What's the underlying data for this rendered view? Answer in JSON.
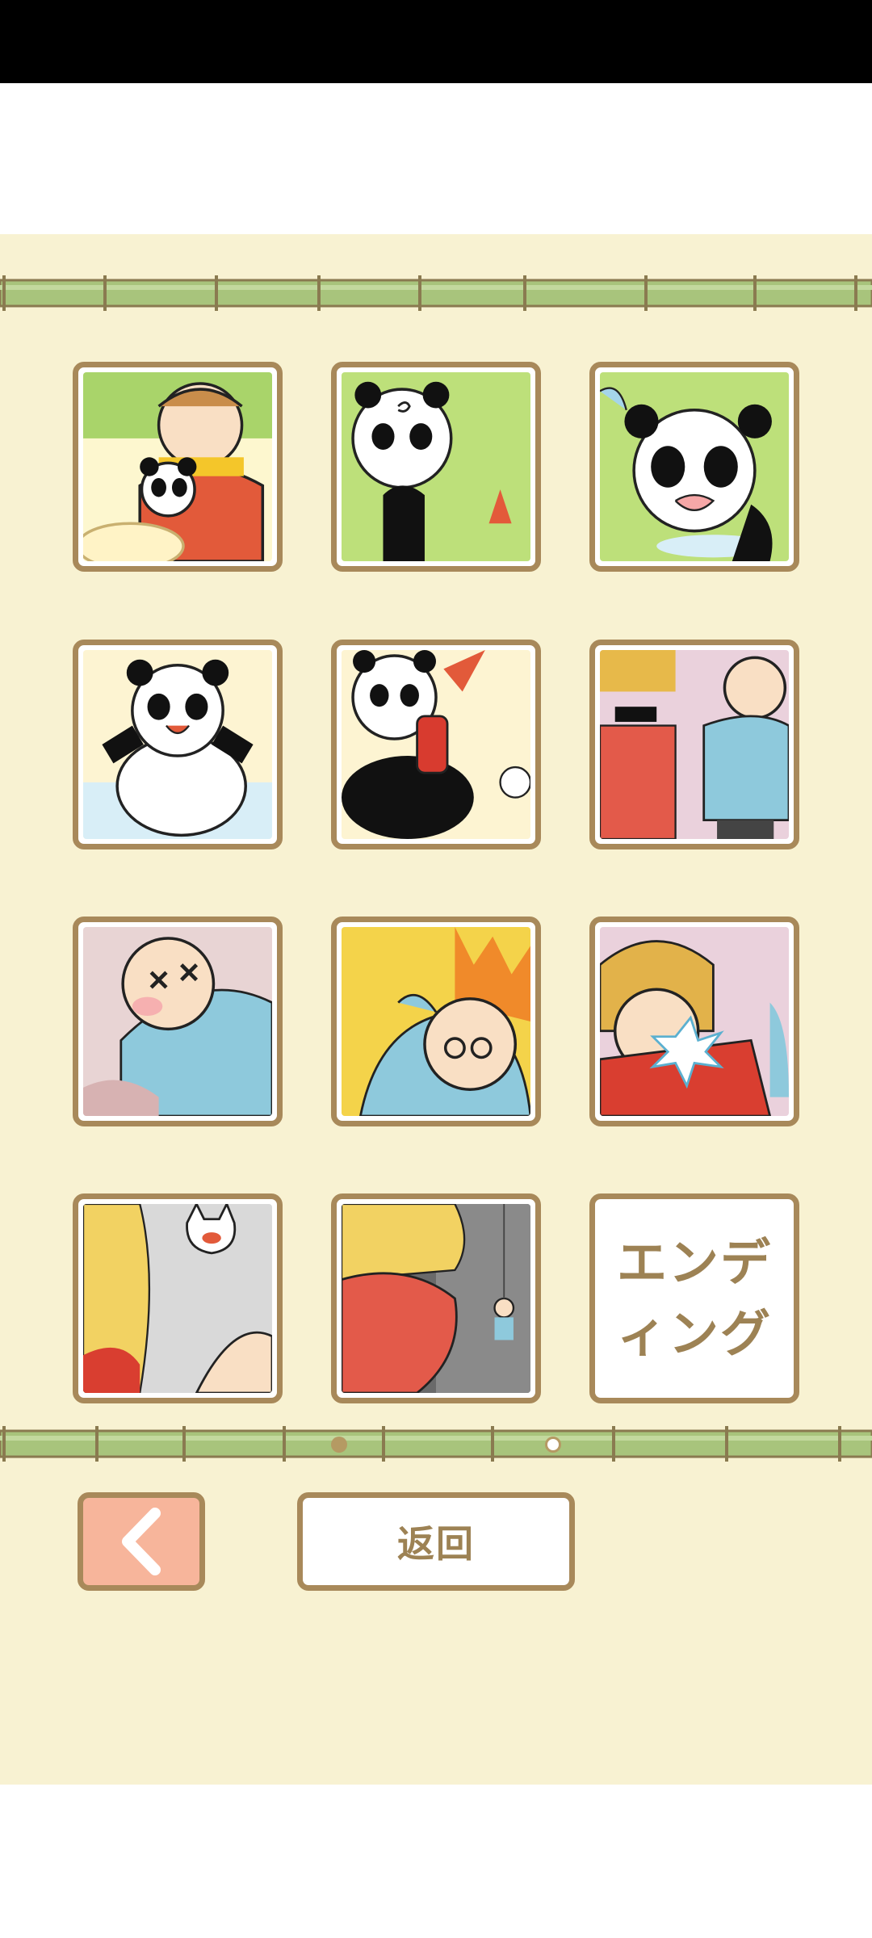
{
  "gallery": {
    "thumbnails": [
      {
        "label": "monkey-king-with-panda-scene"
      },
      {
        "label": "injured-panda-scene"
      },
      {
        "label": "crying-panda-scene"
      },
      {
        "label": "happy-panda-scene"
      },
      {
        "label": "panda-fire-extinguisher-scene"
      },
      {
        "label": "workers-in-red-and-blue-scene"
      },
      {
        "label": "dizzy-old-worker-scene"
      },
      {
        "label": "old-worker-fire-scene"
      },
      {
        "label": "blonde-man-shouting-scene"
      },
      {
        "label": "white-fox-scene"
      },
      {
        "label": "looking-down-scene"
      }
    ],
    "ending_label": "エンデ\nィング"
  },
  "pagination": {
    "total_pages": 2,
    "current_page": 2
  },
  "controls": {
    "back_label": "返回",
    "prev_icon": "chevron-left-icon"
  },
  "colors": {
    "panel_bg": "#f8f2d2",
    "frame": "#a8895a",
    "accent": "#f7b59b",
    "bamboo": "#a8c47c"
  }
}
